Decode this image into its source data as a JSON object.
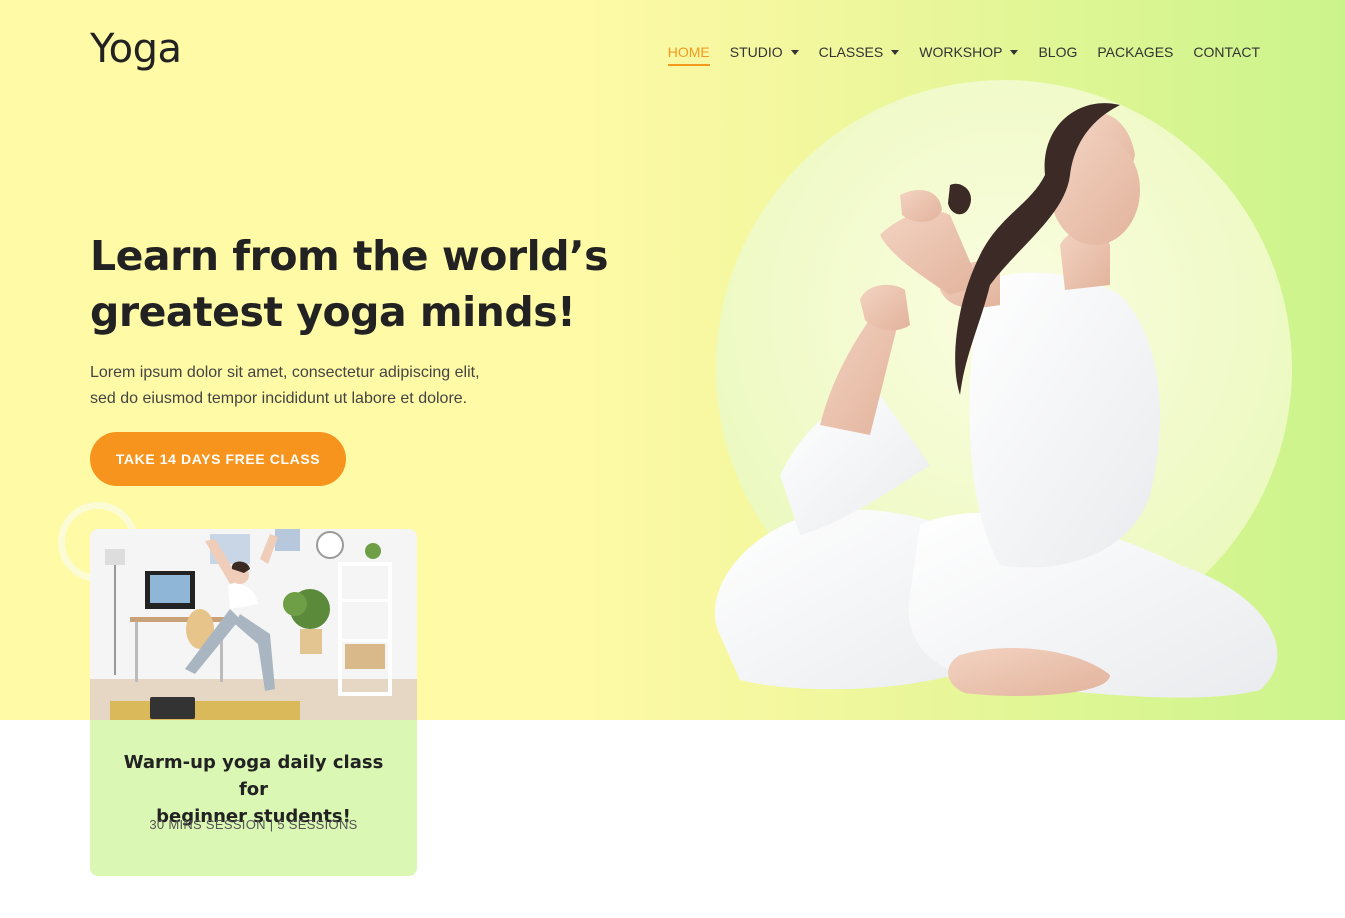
{
  "site": {
    "logo": "Yoga"
  },
  "nav": [
    {
      "label": "HOME",
      "active": true,
      "dropdown": false
    },
    {
      "label": "STUDIO",
      "active": false,
      "dropdown": true
    },
    {
      "label": "CLASSES",
      "active": false,
      "dropdown": true
    },
    {
      "label": "WORKSHOP",
      "active": false,
      "dropdown": true
    },
    {
      "label": "BLOG",
      "active": false,
      "dropdown": false
    },
    {
      "label": "PACKAGES",
      "active": false,
      "dropdown": false
    },
    {
      "label": "CONTACT",
      "active": false,
      "dropdown": false
    }
  ],
  "hero": {
    "title_line1": "Learn from the world’s",
    "title_line2": "greatest yoga minds!",
    "lead_line1": "Lorem ipsum dolor sit amet, consectetur adipiscing elit,",
    "lead_line2": "sed do eiusmod tempor incididunt ut labore et dolore.",
    "cta": "TAKE 14 DAYS FREE CLASS"
  },
  "card": {
    "title_line1": "Warm-up yoga daily class for",
    "title_line2": "beginner students!",
    "meta": "30 MINS SESSION | 5 SESSIONS"
  },
  "colors": {
    "accent": "#f7941d",
    "hero_left": "#fffaa6",
    "hero_right": "#cbf38c",
    "card_bg": "#dbf7b4"
  }
}
